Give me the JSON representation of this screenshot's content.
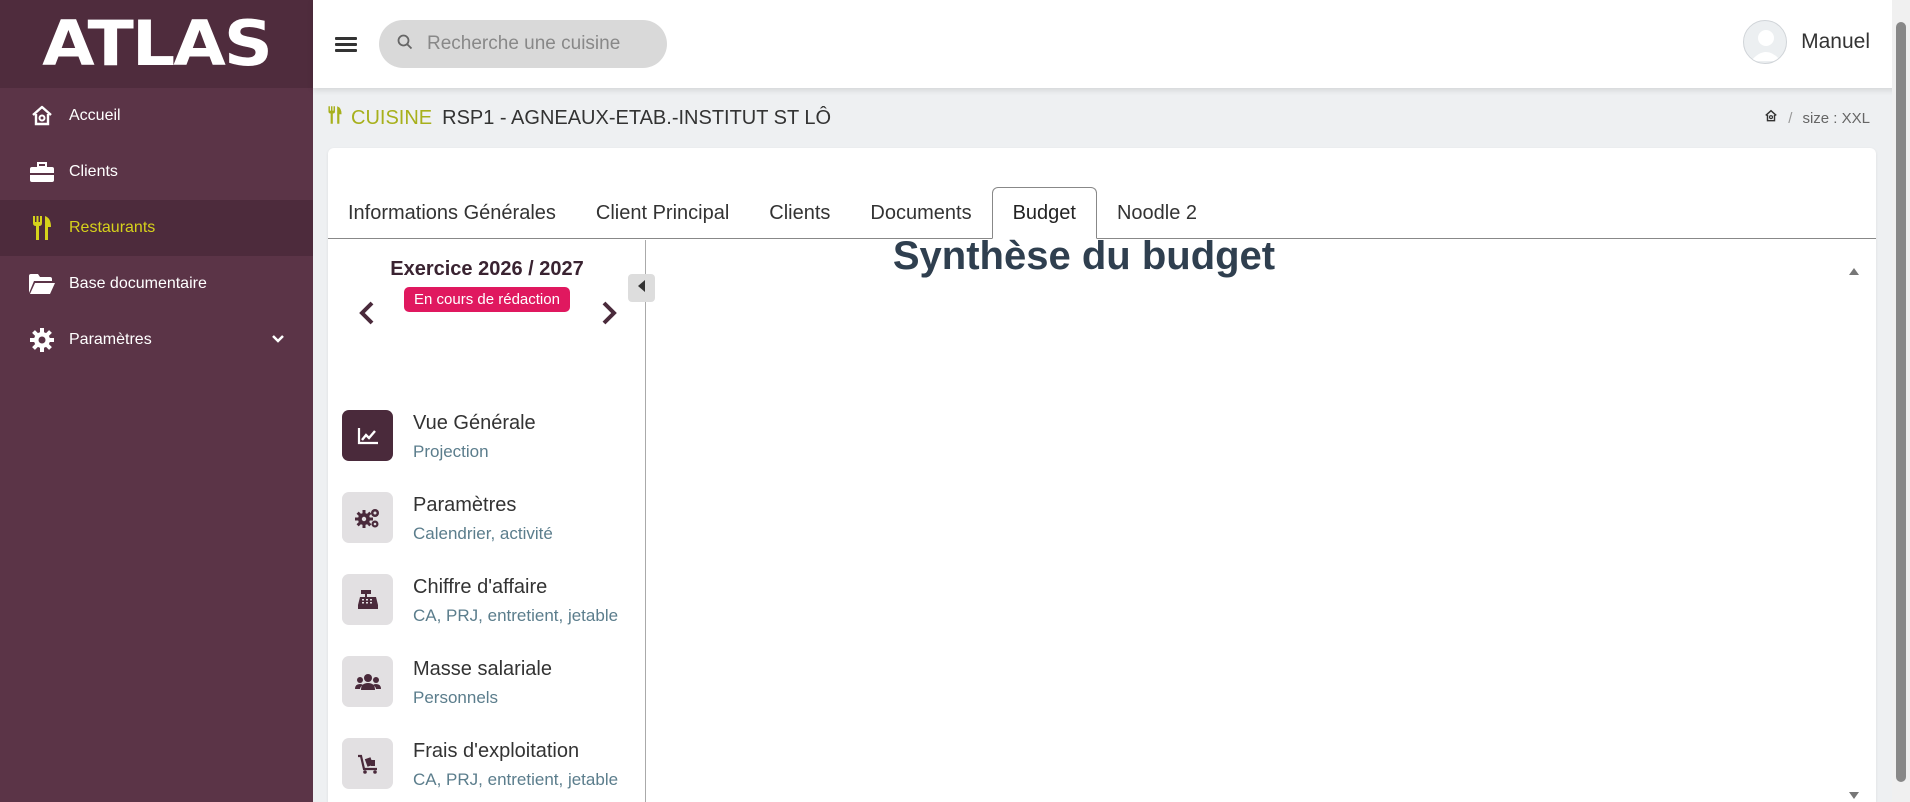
{
  "sidebar": {
    "logo": "ATLAS",
    "items": [
      {
        "label": "Accueil",
        "icon": "home-icon"
      },
      {
        "label": "Clients",
        "icon": "briefcase-icon"
      },
      {
        "label": "Restaurants",
        "icon": "utensils-icon",
        "active": true
      },
      {
        "label": "Base documentaire",
        "icon": "folder-open-icon"
      },
      {
        "label": "Paramètres",
        "icon": "gear-icon"
      }
    ]
  },
  "topbar": {
    "search_placeholder": "Recherche une cuisine",
    "username": "Manuel"
  },
  "header": {
    "category": "CUISINE",
    "name": "RSP1 - AGNEAUX-ETAB.-INSTITUT ST LÔ",
    "breadcrumb_size": "size : XXL"
  },
  "tabs": [
    {
      "label": "Informations Générales"
    },
    {
      "label": "Client Principal"
    },
    {
      "label": "Clients"
    },
    {
      "label": "Documents"
    },
    {
      "label": "Budget",
      "active": true
    },
    {
      "label": "Noodle 2"
    }
  ],
  "exercise": {
    "title": "Exercice 2026 / 2027",
    "status": "En cours de rédaction"
  },
  "menu": [
    {
      "title": "Vue Générale",
      "subtitle": "Projection",
      "icon": "chart-line-icon"
    },
    {
      "title": "Paramètres",
      "subtitle": "Calendrier, activité",
      "icon": "gears-icon"
    },
    {
      "title": "Chiffre d'affaire",
      "subtitle": "CA, PRJ, entretient, jetable",
      "icon": "cash-register-icon"
    },
    {
      "title": "Masse salariale",
      "subtitle": "Personnels",
      "icon": "users-icon"
    },
    {
      "title": "Frais d'exploitation",
      "subtitle": "CA, PRJ, entretient, jetable",
      "icon": "cart-flatbed-icon"
    }
  ],
  "main": {
    "title": "Synthèse du budget"
  },
  "colors": {
    "sidebar": "#5b3447",
    "accent_active": "#d6d21b",
    "category": "#a7b01c",
    "badge": "#e0185f"
  }
}
